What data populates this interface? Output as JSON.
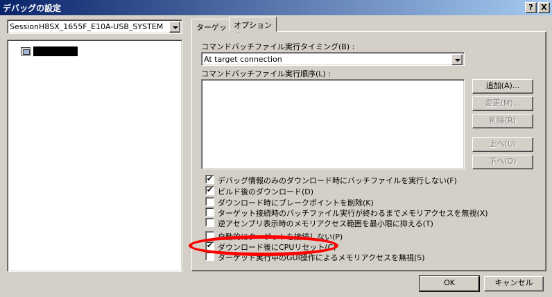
{
  "window": {
    "title": "デバッグの設定",
    "help_btn": "?",
    "close_btn": "X"
  },
  "session": {
    "selected": "SessionH8SX_1655F_E10A-USB_SYSTEM"
  },
  "tabs": [
    {
      "label": "ターゲット"
    },
    {
      "label": "オプション",
      "active": true
    }
  ],
  "options": {
    "timing_label": "コマンドバッチファイル実行タイミング(B) :",
    "timing_value": "At target connection",
    "order_label": "コマンドバッチファイル実行順序(L) :",
    "buttons": {
      "add": "追加(A)...",
      "change": "変更(M)...",
      "delete": "削除(R)",
      "up": "上へ(U)",
      "down": "下へ(O)"
    },
    "checkboxes": [
      {
        "label": "デバッグ情報のみのダウンロード時にバッチファイルを実行しない(F)",
        "checked": true
      },
      {
        "label": "ビルド後のダウンロード(D)",
        "checked": true
      },
      {
        "label": "ダウンロード時にブレークポイントを削除(K)",
        "checked": false
      },
      {
        "label": "ターゲット接続時のバッチファイル実行が終わるまでメモリアクセスを無視(X)",
        "checked": false
      },
      {
        "label": "逆アセンブリ表示時のメモリアクセス範囲を最小限に抑える(T)",
        "checked": false
      },
      {
        "label": "自動的にターゲットを接続しない(P)",
        "checked": false
      },
      {
        "label": "ダウンロード後にCPUリセット(C)",
        "checked": true
      },
      {
        "label": "ターゲット実行中のGUI操作によるメモリアクセスを無視(S)",
        "checked": false
      }
    ]
  },
  "footer": {
    "ok": "OK",
    "cancel": "キャンセル"
  },
  "colors": {
    "highlight": "#ff0000",
    "titlebar_start": "#0a246a",
    "titlebar_end": "#a6caf0"
  }
}
